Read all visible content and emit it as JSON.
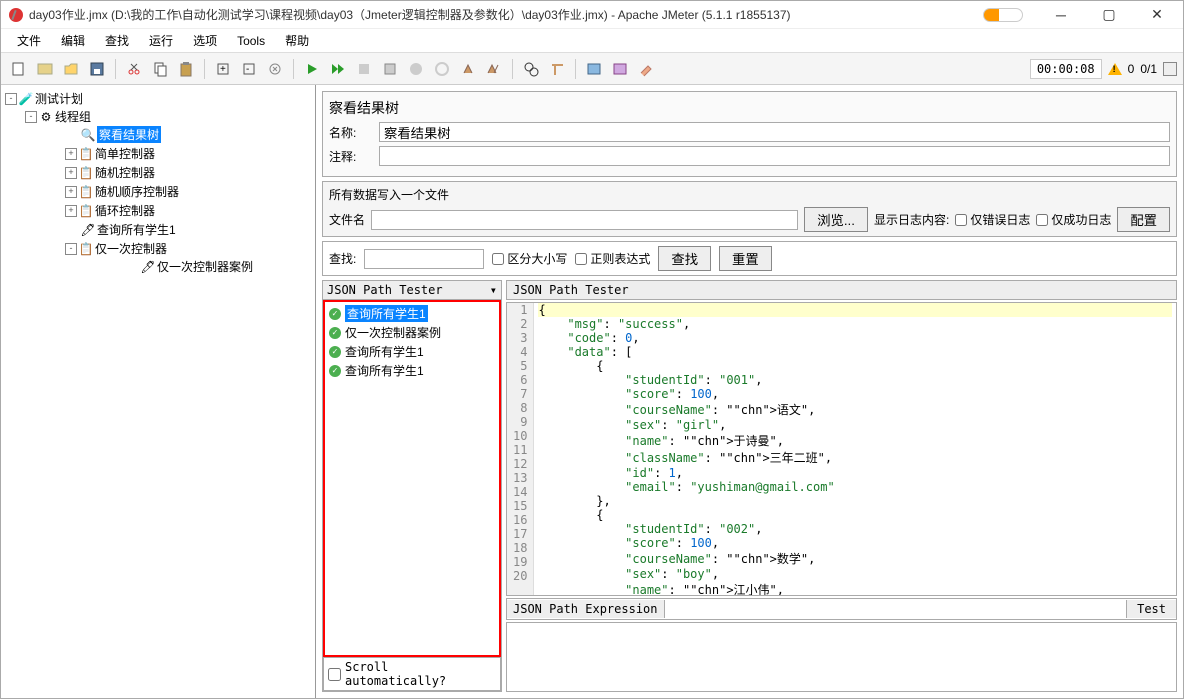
{
  "title": "day03作业.jmx (D:\\我的工作\\自动化测试学习\\课程视频\\day03（Jmeter逻辑控制器及参数化）\\day03作业.jmx) - Apache JMeter (5.1.1 r1855137)",
  "menu": {
    "file": "文件",
    "edit": "编辑",
    "find": "查找",
    "run": "运行",
    "options": "选项",
    "tools": "Tools",
    "help": "帮助"
  },
  "toolbarRight": {
    "timer": "00:00:08",
    "counter": "0/1"
  },
  "tree": {
    "root": "测试计划",
    "threadGroup": "线程组",
    "viewResults": "察看结果树",
    "simpleCtrl": "简单控制器",
    "randomCtrl": "随机控制器",
    "randomOrderCtrl": "随机顺序控制器",
    "loopCtrl": "循环控制器",
    "queryAll": "查询所有学生1",
    "onceOnly": "仅一次控制器",
    "onceOnlyCase": "仅一次控制器案例"
  },
  "rightPanel": {
    "title": "察看结果树",
    "nameLabel": "名称:",
    "nameValue": "察看结果树",
    "commentLabel": "注释:",
    "fileSection": "所有数据写入一个文件",
    "fileNameLabel": "文件名",
    "browse": "浏览...",
    "showLogLabel": "显示日志内容:",
    "errorOnly": "仅错误日志",
    "successOnly": "仅成功日志",
    "configure": "配置",
    "searchLabel": "查找:",
    "caseSensitive": "区分大小写",
    "regex": "正则表达式",
    "searchBtn": "查找",
    "resetBtn": "重置",
    "dropdown": "JSON Path Tester",
    "jsonTester": "JSON Path Tester",
    "jsonPathExpr": "JSON Path Expression",
    "testBtn": "Test",
    "scrollAuto": "Scroll automatically?"
  },
  "results": [
    "查询所有学生1",
    "仅一次控制器案例",
    "查询所有学生1",
    "查询所有学生1"
  ],
  "code": [
    {
      "n": 1,
      "t": "{",
      "hl": true
    },
    {
      "n": 2,
      "t": "    \"msg\": \"success\","
    },
    {
      "n": 3,
      "t": "    \"code\": 0,"
    },
    {
      "n": 4,
      "t": "    \"data\": ["
    },
    {
      "n": 5,
      "t": "        {"
    },
    {
      "n": 6,
      "t": "            \"studentId\": \"001\","
    },
    {
      "n": 7,
      "t": "            \"score\": 100,"
    },
    {
      "n": 8,
      "t": "            \"courseName\": \"语文\","
    },
    {
      "n": 9,
      "t": "            \"sex\": \"girl\","
    },
    {
      "n": 10,
      "t": "            \"name\": \"于诗曼\","
    },
    {
      "n": 11,
      "t": "            \"className\": \"三年二班\","
    },
    {
      "n": 12,
      "t": "            \"id\": 1,"
    },
    {
      "n": 13,
      "t": "            \"email\": \"yushiman@gmail.com\""
    },
    {
      "n": 14,
      "t": "        },"
    },
    {
      "n": 15,
      "t": "        {"
    },
    {
      "n": 16,
      "t": "            \"studentId\": \"002\","
    },
    {
      "n": 17,
      "t": "            \"score\": 100,"
    },
    {
      "n": 18,
      "t": "            \"courseName\": \"数学\","
    },
    {
      "n": 19,
      "t": "            \"sex\": \"boy\","
    },
    {
      "n": 20,
      "t": "            \"name\": \"江小伟\","
    }
  ]
}
